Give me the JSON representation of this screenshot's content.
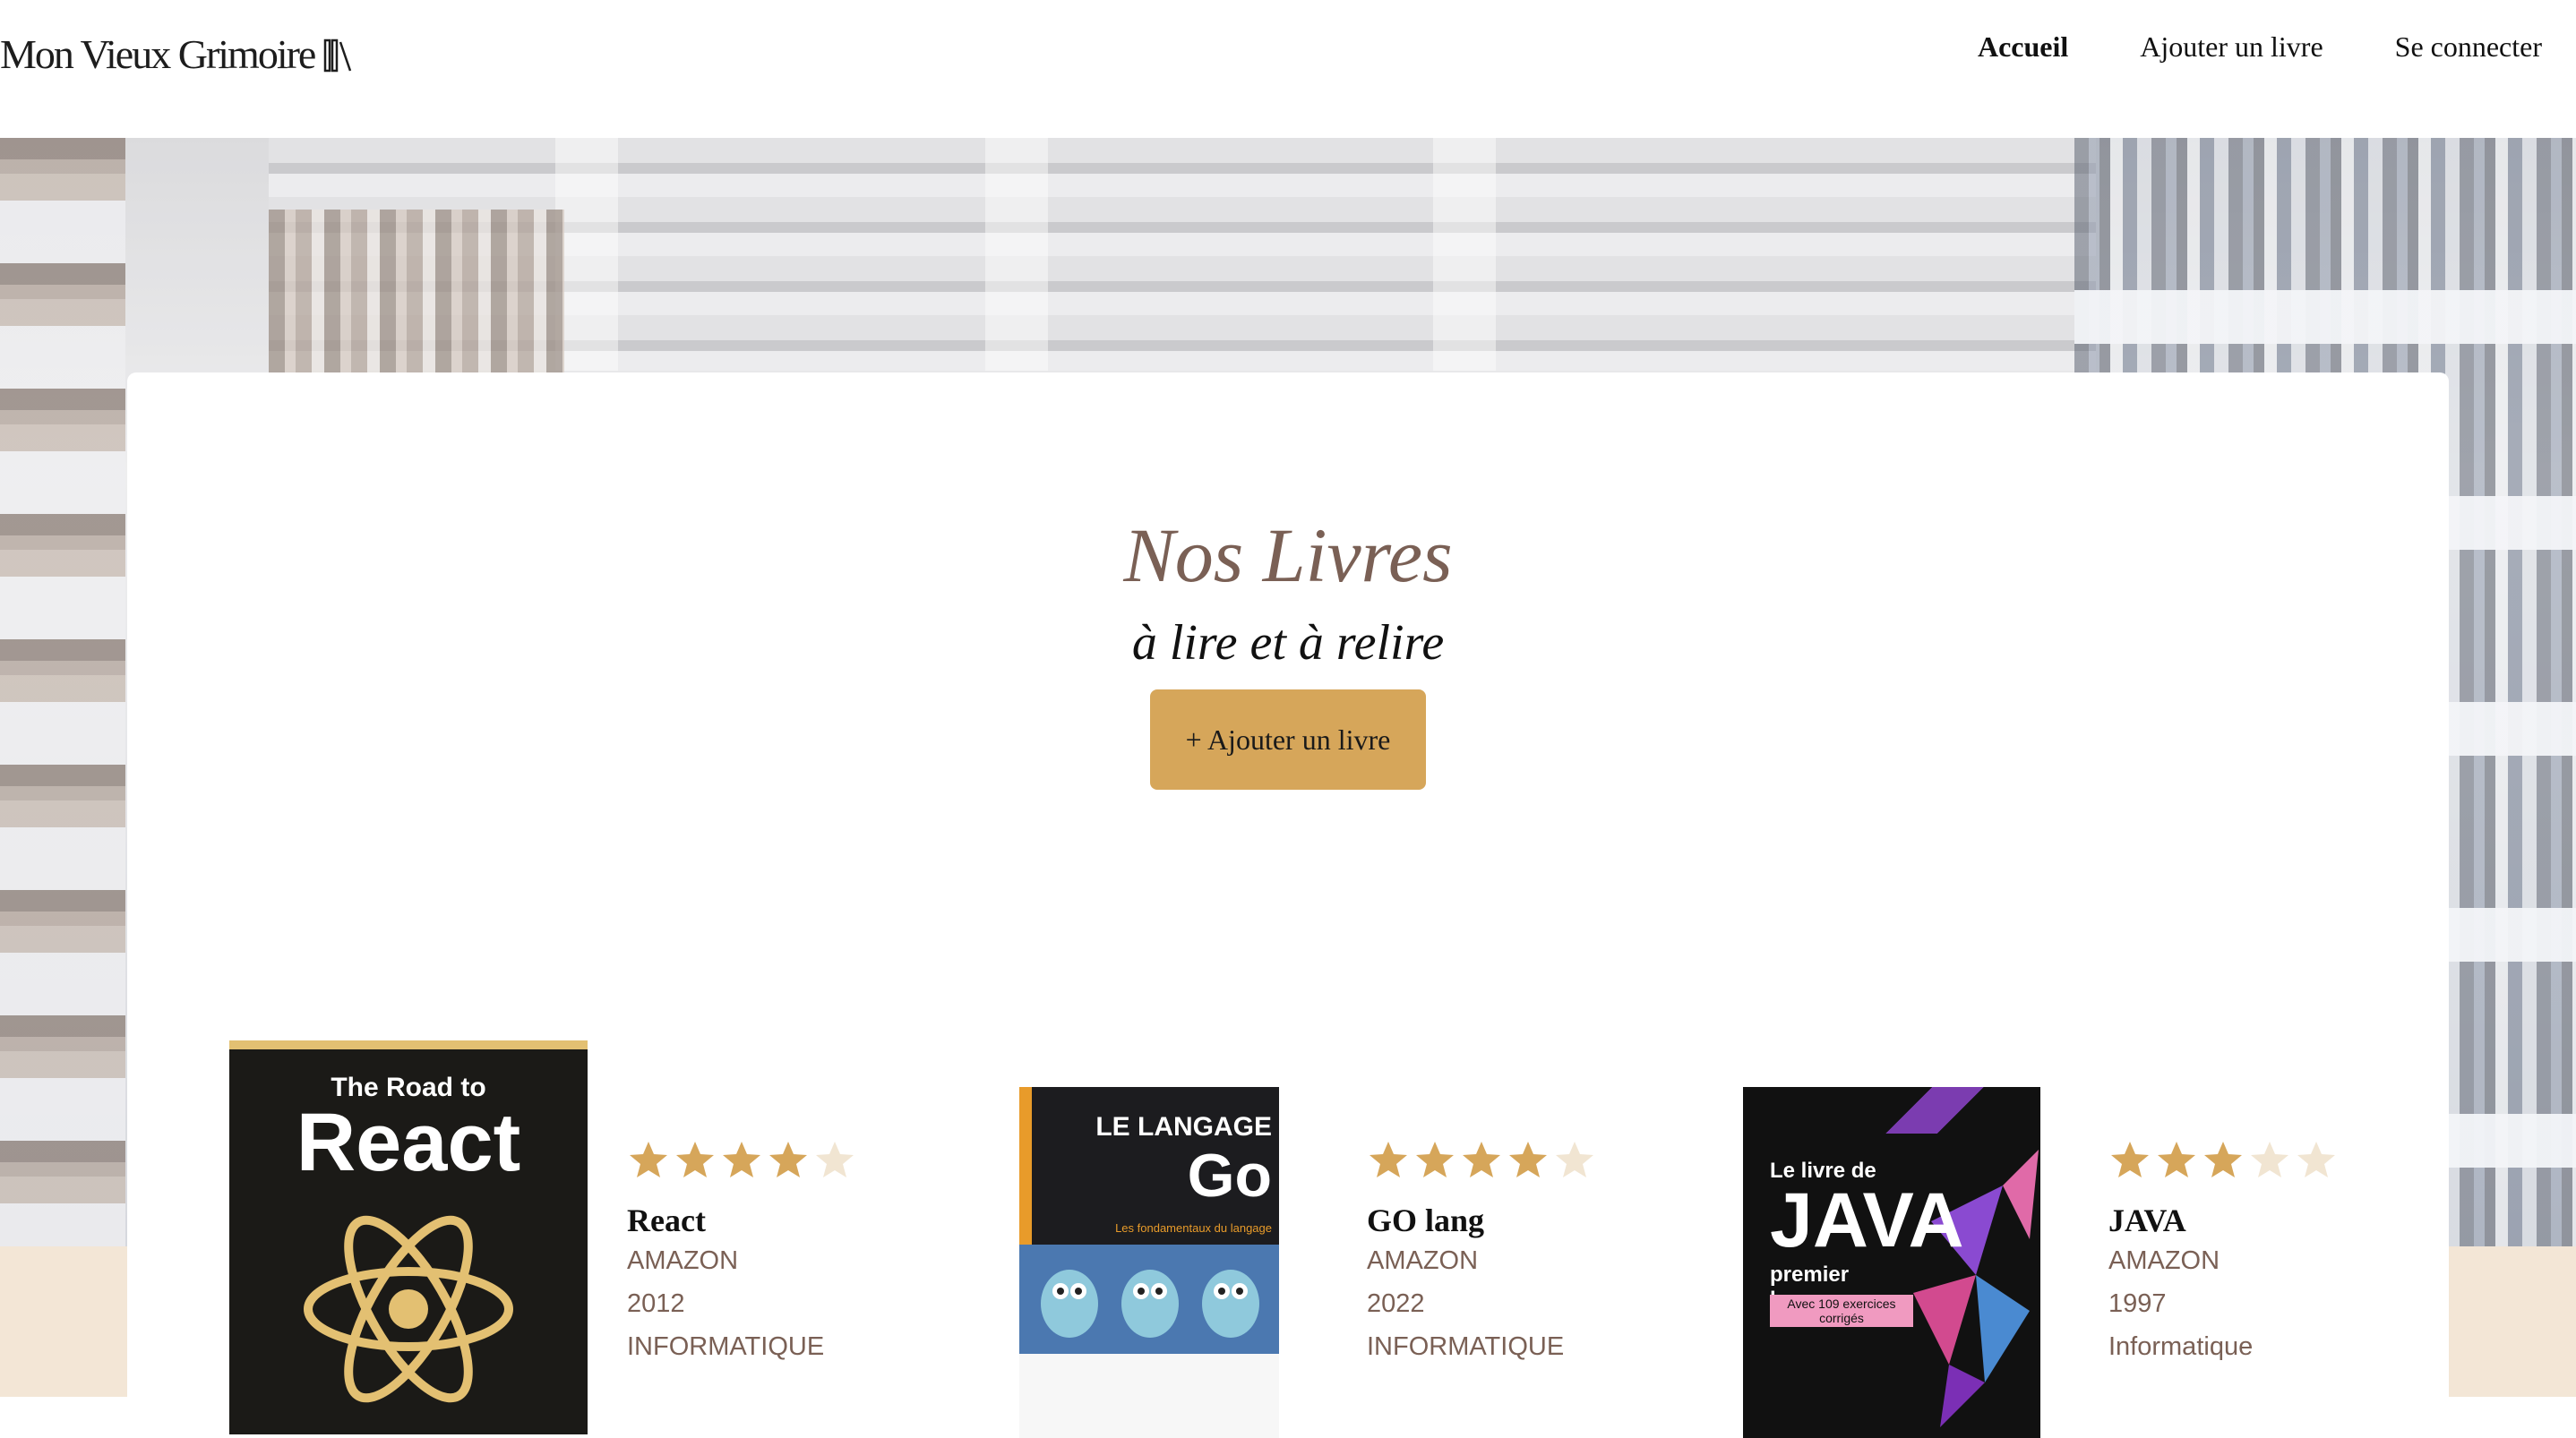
{
  "header": {
    "logo_text": "Mon Vieux Grimoire",
    "nav": [
      {
        "label": "Accueil",
        "active": true
      },
      {
        "label": "Ajouter un livre",
        "active": false
      },
      {
        "label": "Se connecter",
        "active": false
      }
    ]
  },
  "main": {
    "title": "Nos Livres",
    "subtitle": "à lire et à relire",
    "add_button": "+ Ajouter un livre"
  },
  "books": [
    {
      "title": "React",
      "publisher": "AMAZON",
      "year": "2012",
      "genre": "INFORMATIQUE",
      "rating": 4,
      "cover_text_1": "The Road to",
      "cover_text_2": "React"
    },
    {
      "title": "GO lang",
      "publisher": "AMAZON",
      "year": "2022",
      "genre": "INFORMATIQUE",
      "rating": 4,
      "cover_text_1": "LE LANGAGE",
      "cover_text_2": "Go",
      "cover_text_3": "Les fondamentaux du langage"
    },
    {
      "title": "JAVA",
      "publisher": "AMAZON",
      "year": "1997",
      "genre": "Informatique",
      "rating": 3,
      "cover_text_1": "Le livre de",
      "cover_text_2": "JAVA",
      "cover_text_3": "premier langage",
      "cover_text_4": "Avec 109 exercices corrigés"
    }
  ],
  "colors": {
    "accent": "#d6a65a",
    "title": "#7a6055",
    "star_on": "#d6a65a",
    "star_off": "#f1e5d2"
  }
}
